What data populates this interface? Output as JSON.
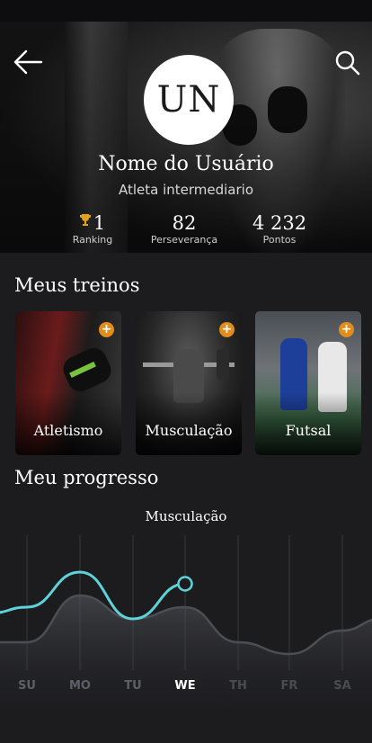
{
  "profile": {
    "avatar_initials": "UN",
    "name": "Nome do Usuário",
    "level": "Atleta intermediario",
    "stats": [
      {
        "value": "1",
        "label": "Ranking"
      },
      {
        "value": "82",
        "label": "Perseverança"
      },
      {
        "value": "4 232",
        "label": "Pontos"
      }
    ]
  },
  "trainings": {
    "title": "Meus treinos",
    "add_symbol": "+",
    "cards": [
      {
        "name": "Atletismo"
      },
      {
        "name": "Musculação"
      },
      {
        "name": "Futsal"
      }
    ]
  },
  "progress": {
    "title": "Meu progresso",
    "accent": "#5dd3d8",
    "chart_data": {
      "type": "line",
      "title": "Musculação",
      "categories": [
        "SU",
        "MO",
        "TU",
        "WE",
        "TH",
        "FR",
        "SA"
      ],
      "selected": "WE",
      "series": [
        {
          "values": [
            5,
            8,
            4,
            7
          ]
        },
        {
          "values": [
            2,
            6,
            4,
            5,
            2,
            1,
            3
          ]
        }
      ],
      "ylim": [
        0,
        10
      ],
      "grid": true
    }
  }
}
